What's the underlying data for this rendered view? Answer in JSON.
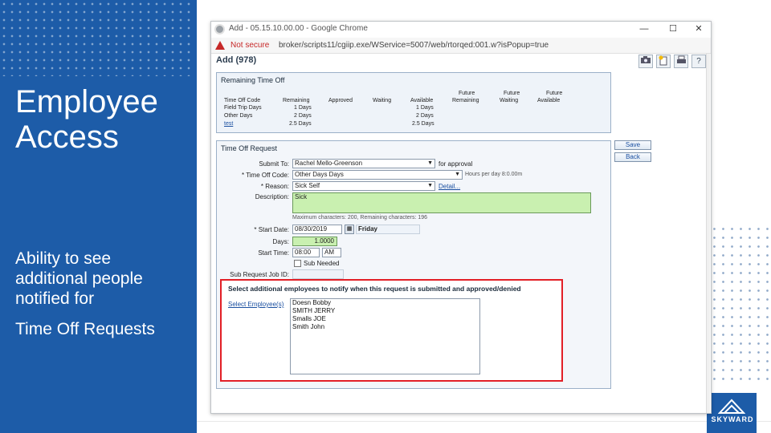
{
  "slide": {
    "title_line1": "Employee",
    "title_line2": "Access",
    "body_line": "Ability to see additional people notified for",
    "body_line2": "Time Off Requests"
  },
  "browser": {
    "window_title": "Add - 05.15.10.00.00 - Google Chrome",
    "not_secure": "Not secure",
    "url": "broker/scripts11/cgiip.exe/WService=5007/web/rtorqed:001.w?isPopup=true",
    "minimize": "—",
    "maximize": "☐",
    "close": "✕"
  },
  "page": {
    "title": "Add (978)",
    "toolbar_icons": [
      "camera-icon",
      "new-page-icon",
      "print-icon",
      "help-icon"
    ],
    "toolbar_help": "?"
  },
  "remaining": {
    "header": "Remaining Time Off",
    "columns": [
      "Time Off Code",
      "Remaining",
      "Approved",
      "Waiting",
      "Available",
      "Future Remaining",
      "Future Waiting",
      "Future Available"
    ],
    "future_top": [
      "Future",
      "Future",
      "Future"
    ],
    "future_bottom": [
      "Remaining",
      "Waiting",
      "Available"
    ],
    "rows": [
      {
        "code": "Field Trip Days",
        "remaining": "1 Days",
        "available": "1 Days"
      },
      {
        "code": "Other Days",
        "remaining": "2 Days",
        "available": "2 Days"
      },
      {
        "code": "test",
        "remaining": "2.5 Days",
        "available": "2.5 Days"
      }
    ]
  },
  "request": {
    "header": "Time Off Request",
    "submit_to_label": "Submit To:",
    "submit_to_value": "Rachel Mello-Greenson",
    "submit_to_suffix": "for approval",
    "code_label": "* Time Off Code:",
    "code_value": "Other Days          Days",
    "code_note": "Hours per day 8:0.00m",
    "reason_label": "* Reason:",
    "reason_value": "Sick Self",
    "detail_link": "Detail...",
    "description_label": "Description:",
    "description_value": "Sick",
    "char_note": "Maximum characters: 200, Remaining characters: 196",
    "start_date_label": "* Start Date:",
    "start_date_value": "08/30/2019",
    "start_day": "Friday",
    "days_label": "Days:",
    "days_value": "1.0000",
    "start_time_label": "Start Time:",
    "start_time_value": "08:00",
    "ampm_value": "AM",
    "sub_needed_label": "Sub Needed",
    "sub_job_label": "Sub Request Job ID:"
  },
  "notify": {
    "header": "Select additional employees to notify when this request is submitted and approved/denied",
    "select_link": "Select Employee(s)",
    "employees": [
      "Doesn Bobby",
      "SMITH JERRY",
      "Smalls JOE",
      "Smith John"
    ]
  },
  "side_buttons": {
    "save": "Save",
    "back": "Back"
  },
  "brand": {
    "logo_text": "SKYWARD",
    "accent_blue": "#1d5ca8",
    "highlight_red": "#e21f26"
  }
}
